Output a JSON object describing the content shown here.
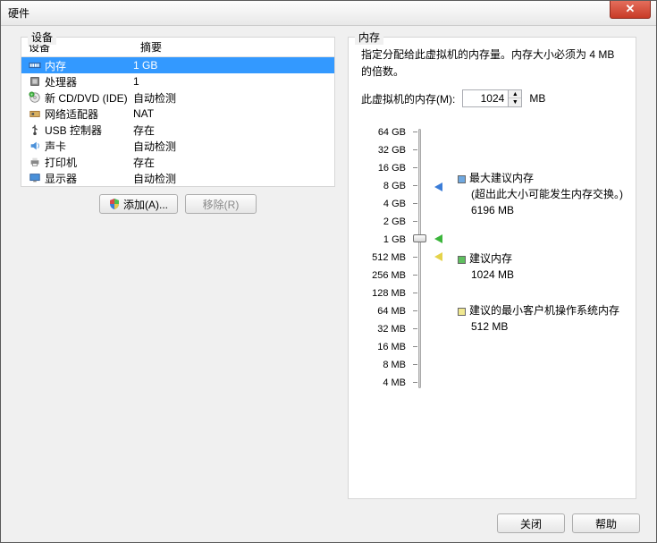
{
  "window_title": "硬件",
  "left_group": "设备",
  "right_group": "内存",
  "headers": {
    "device": "设备",
    "summary": "摘要"
  },
  "devices": [
    {
      "name": "内存",
      "summary": "1 GB",
      "icon": "memory",
      "selected": true
    },
    {
      "name": "处理器",
      "summary": "1",
      "icon": "cpu"
    },
    {
      "name": "新 CD/DVD (IDE)",
      "summary": "自动检测",
      "icon": "cd"
    },
    {
      "name": "网络适配器",
      "summary": "NAT",
      "icon": "nic"
    },
    {
      "name": "USB 控制器",
      "summary": "存在",
      "icon": "usb"
    },
    {
      "name": "声卡",
      "summary": "自动检测",
      "icon": "sound"
    },
    {
      "name": "打印机",
      "summary": "存在",
      "icon": "printer"
    },
    {
      "name": "显示器",
      "summary": "自动检测",
      "icon": "display"
    }
  ],
  "add_btn": "添加(A)...",
  "remove_btn": "移除(R)",
  "mem_desc": "指定分配给此虚拟机的内存量。内存大小必须为 4 MB 的倍数。",
  "mem_label": "此虚拟机的内存(M):",
  "mem_value": "1024",
  "mem_unit": "MB",
  "ticks": [
    "64 GB",
    "32 GB",
    "16 GB",
    "8 GB",
    "4 GB",
    "2 GB",
    "1 GB",
    "512 MB",
    "256 MB",
    "128 MB",
    "64 MB",
    "32 MB",
    "16 MB",
    "8 MB",
    "4 MB"
  ],
  "legend_max": {
    "title": "最大建议内存",
    "note": "(超出此大小可能发生内存交换。)",
    "value": "6196 MB"
  },
  "legend_rec": {
    "title": "建议内存",
    "value": "1024 MB"
  },
  "legend_min": {
    "title": "建议的最小客户机操作系统内存",
    "value": "512 MB"
  },
  "close_btn": "关闭",
  "help_btn": "帮助"
}
